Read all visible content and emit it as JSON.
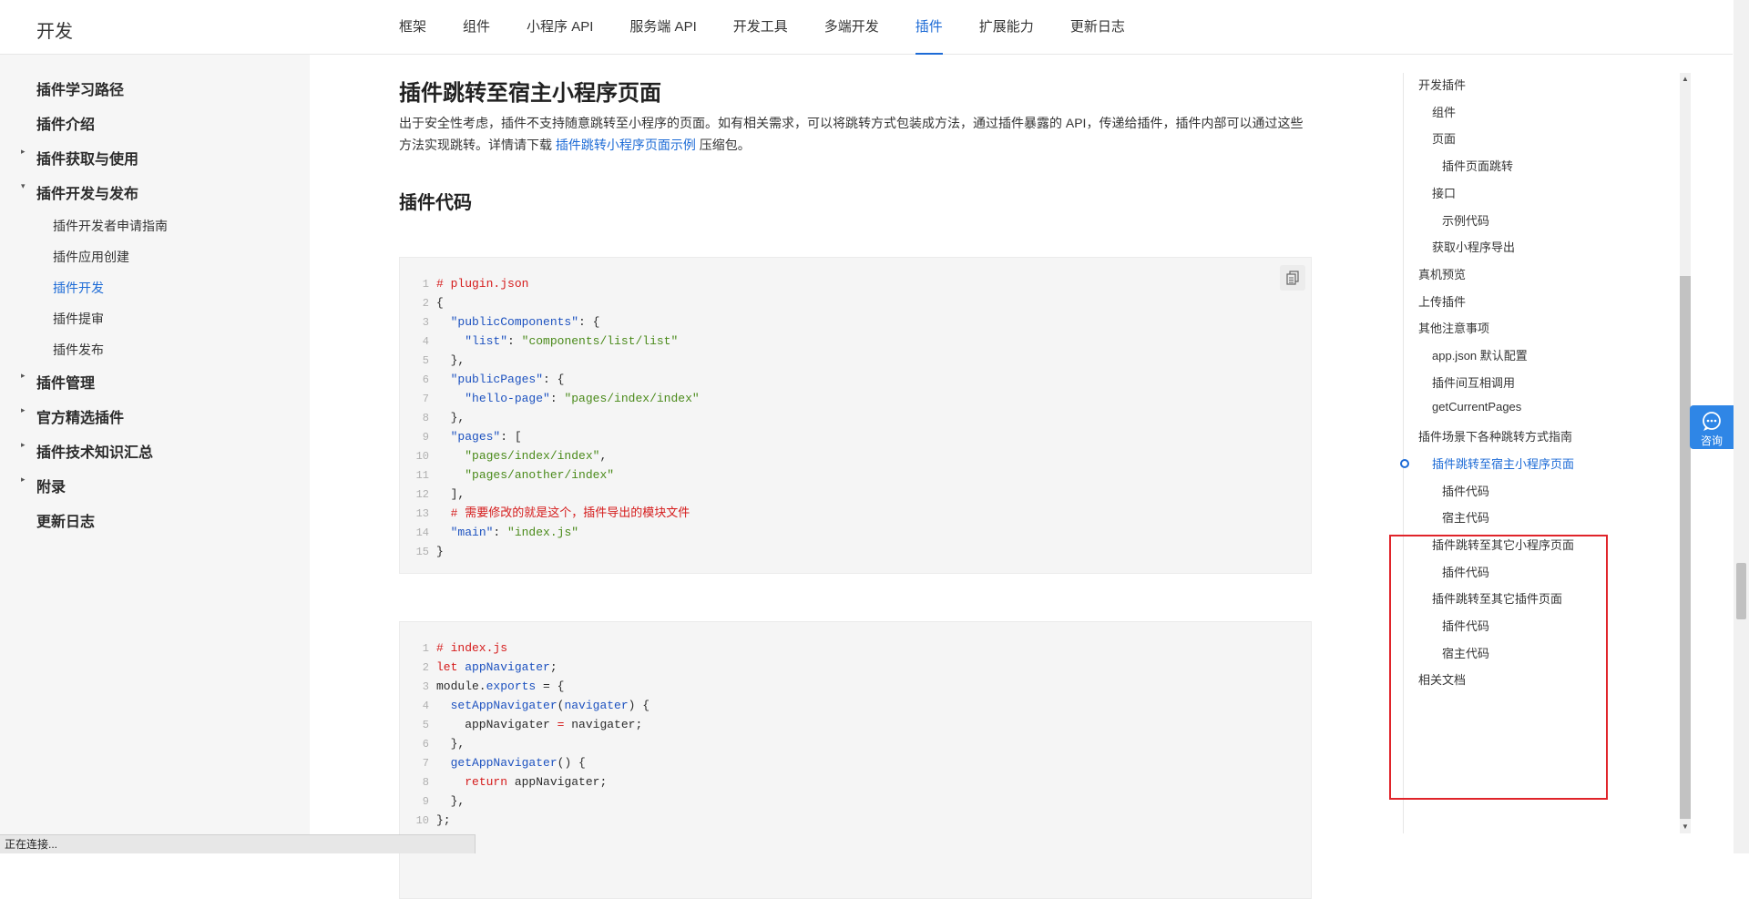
{
  "header": {
    "brand": "开发",
    "tabs": [
      {
        "label": "框架"
      },
      {
        "label": "组件"
      },
      {
        "label": "小程序 API"
      },
      {
        "label": "服务端 API"
      },
      {
        "label": "开发工具"
      },
      {
        "label": "多端开发"
      },
      {
        "label": "插件",
        "active": true
      },
      {
        "label": "扩展能力"
      },
      {
        "label": "更新日志"
      }
    ]
  },
  "sidebar": {
    "items": [
      {
        "label": "插件学习路径"
      },
      {
        "label": "插件介绍"
      },
      {
        "label": "插件获取与使用",
        "arrow": "▸"
      },
      {
        "label": "插件开发与发布",
        "arrow": "▾"
      },
      {
        "label": "插件管理",
        "arrow": "▸"
      },
      {
        "label": "官方精选插件",
        "arrow": "▸"
      },
      {
        "label": "插件技术知识汇总",
        "arrow": "▸"
      },
      {
        "label": "附录",
        "arrow": "▸"
      },
      {
        "label": "更新日志"
      }
    ],
    "subitems": [
      {
        "label": "插件开发者申请指南"
      },
      {
        "label": "插件应用创建"
      },
      {
        "label": "插件开发",
        "active": true
      },
      {
        "label": "插件提审"
      },
      {
        "label": "插件发布"
      }
    ]
  },
  "main": {
    "title": "插件跳转至宿主小程序页面",
    "intro_before": "出于安全性考虑，插件不支持随意跳转至小程序的页面。如有相关需求，可以将跳转方式包装成方法，通过插件暴露的 API，传递给插件，插件内部可以通过这些方法实现跳转。详情请下载 ",
    "intro_link": "插件跳转小程序页面示例",
    "intro_after": " 压缩包。",
    "section_heading": "插件代码",
    "code1": [
      {
        "n": "1",
        "parts": [
          {
            "t": "# plugin.json",
            "c": "c-red"
          }
        ]
      },
      {
        "n": "2",
        "parts": [
          {
            "t": "{",
            "c": "c-dark"
          }
        ]
      },
      {
        "n": "3",
        "parts": [
          {
            "t": "  ",
            "c": "c-dark"
          },
          {
            "t": "\"publicComponents\"",
            "c": "c-blue"
          },
          {
            "t": ": {",
            "c": "c-dark"
          }
        ]
      },
      {
        "n": "4",
        "parts": [
          {
            "t": "    ",
            "c": "c-dark"
          },
          {
            "t": "\"list\"",
            "c": "c-blue"
          },
          {
            "t": ": ",
            "c": "c-dark"
          },
          {
            "t": "\"components/list/list\"",
            "c": "c-green"
          }
        ]
      },
      {
        "n": "5",
        "parts": [
          {
            "t": "  },",
            "c": "c-dark"
          }
        ]
      },
      {
        "n": "6",
        "parts": [
          {
            "t": "  ",
            "c": "c-dark"
          },
          {
            "t": "\"publicPages\"",
            "c": "c-blue"
          },
          {
            "t": ": {",
            "c": "c-dark"
          }
        ]
      },
      {
        "n": "7",
        "parts": [
          {
            "t": "    ",
            "c": "c-dark"
          },
          {
            "t": "\"hello-page\"",
            "c": "c-blue"
          },
          {
            "t": ": ",
            "c": "c-dark"
          },
          {
            "t": "\"pages/index/index\"",
            "c": "c-green"
          }
        ]
      },
      {
        "n": "8",
        "parts": [
          {
            "t": "  },",
            "c": "c-dark"
          }
        ]
      },
      {
        "n": "9",
        "parts": [
          {
            "t": "  ",
            "c": "c-dark"
          },
          {
            "t": "\"pages\"",
            "c": "c-blue"
          },
          {
            "t": ": [",
            "c": "c-dark"
          }
        ]
      },
      {
        "n": "10",
        "parts": [
          {
            "t": "    ",
            "c": "c-dark"
          },
          {
            "t": "\"pages/index/index\"",
            "c": "c-green"
          },
          {
            "t": ",",
            "c": "c-dark"
          }
        ]
      },
      {
        "n": "11",
        "parts": [
          {
            "t": "    ",
            "c": "c-dark"
          },
          {
            "t": "\"pages/another/index\"",
            "c": "c-green"
          }
        ]
      },
      {
        "n": "12",
        "parts": [
          {
            "t": "  ],",
            "c": "c-dark"
          }
        ]
      },
      {
        "n": "13",
        "parts": [
          {
            "t": "  # 需要修改的就是这个，插件导出的模块文件",
            "c": "c-red"
          }
        ]
      },
      {
        "n": "14",
        "parts": [
          {
            "t": "  ",
            "c": "c-dark"
          },
          {
            "t": "\"main\"",
            "c": "c-blue"
          },
          {
            "t": ": ",
            "c": "c-dark"
          },
          {
            "t": "\"index.js\"",
            "c": "c-green"
          }
        ]
      },
      {
        "n": "15",
        "parts": [
          {
            "t": "}",
            "c": "c-dark"
          }
        ]
      }
    ],
    "code2": [
      {
        "n": "1",
        "parts": [
          {
            "t": "# index.js",
            "c": "c-red"
          }
        ]
      },
      {
        "n": "2",
        "parts": [
          {
            "t": "let ",
            "c": "c-red"
          },
          {
            "t": "appNavigater",
            "c": "c-blue"
          },
          {
            "t": ";",
            "c": "c-dark"
          }
        ]
      },
      {
        "n": "3",
        "parts": [
          {
            "t": "module.",
            "c": "c-dark"
          },
          {
            "t": "exports",
            "c": "c-blue"
          },
          {
            "t": " = {",
            "c": "c-dark"
          }
        ]
      },
      {
        "n": "4",
        "parts": [
          {
            "t": "  ",
            "c": "c-dark"
          },
          {
            "t": "setAppNavigater",
            "c": "c-blue"
          },
          {
            "t": "(",
            "c": "c-dark"
          },
          {
            "t": "navigater",
            "c": "c-blue"
          },
          {
            "t": ") {",
            "c": "c-dark"
          }
        ]
      },
      {
        "n": "5",
        "parts": [
          {
            "t": "    appNavigater ",
            "c": "c-dark"
          },
          {
            "t": "=",
            "c": "c-red"
          },
          {
            "t": " navigater;",
            "c": "c-dark"
          }
        ]
      },
      {
        "n": "6",
        "parts": [
          {
            "t": "  },",
            "c": "c-dark"
          }
        ]
      },
      {
        "n": "7",
        "parts": [
          {
            "t": "  ",
            "c": "c-dark"
          },
          {
            "t": "getAppNavigater",
            "c": "c-blue"
          },
          {
            "t": "() {",
            "c": "c-dark"
          }
        ]
      },
      {
        "n": "8",
        "parts": [
          {
            "t": "    ",
            "c": "c-dark"
          },
          {
            "t": "return",
            "c": "c-red"
          },
          {
            "t": " appNavigater;",
            "c": "c-dark"
          }
        ]
      },
      {
        "n": "9",
        "parts": [
          {
            "t": "  },",
            "c": "c-dark"
          }
        ]
      },
      {
        "n": "10",
        "parts": [
          {
            "t": "};",
            "c": "c-dark"
          }
        ]
      }
    ]
  },
  "toc": {
    "items": [
      {
        "label": "开发插件",
        "level": 0
      },
      {
        "label": "组件",
        "level": 1
      },
      {
        "label": "页面",
        "level": 1
      },
      {
        "label": "插件页面跳转",
        "level": 2
      },
      {
        "label": "接口",
        "level": 1
      },
      {
        "label": "示例代码",
        "level": 2
      },
      {
        "label": "获取小程序导出",
        "level": 1
      },
      {
        "label": "真机预览",
        "level": 0
      },
      {
        "label": "上传插件",
        "level": 0
      },
      {
        "label": "其他注意事项",
        "level": 0
      },
      {
        "label": "app.json 默认配置",
        "level": 1
      },
      {
        "label": "插件间互相调用",
        "level": 1
      },
      {
        "label": "getCurrentPages",
        "level": 1
      },
      {
        "label": "插件场景下各种跳转方式指南",
        "level": 0
      },
      {
        "label": "插件跳转至宿主小程序页面",
        "level": 1,
        "active": true
      },
      {
        "label": "插件代码",
        "level": 2
      },
      {
        "label": "宿主代码",
        "level": 2
      },
      {
        "label": "插件跳转至其它小程序页面",
        "level": 1
      },
      {
        "label": "插件代码",
        "level": 2
      },
      {
        "label": "插件跳转至其它插件页面",
        "level": 1
      },
      {
        "label": "插件代码",
        "level": 2
      },
      {
        "label": "宿主代码",
        "level": 2
      },
      {
        "label": "相关文档",
        "level": 0
      }
    ]
  },
  "consult": {
    "label": "咨询"
  },
  "status": {
    "text": "正在连接..."
  },
  "colors": {
    "accent": "#1d6bd6",
    "highlight_box": "#e0242a",
    "consult_bg": "#2f86e6"
  },
  "icons": {
    "copy": "copy-icon",
    "chat": "chat-icon"
  }
}
